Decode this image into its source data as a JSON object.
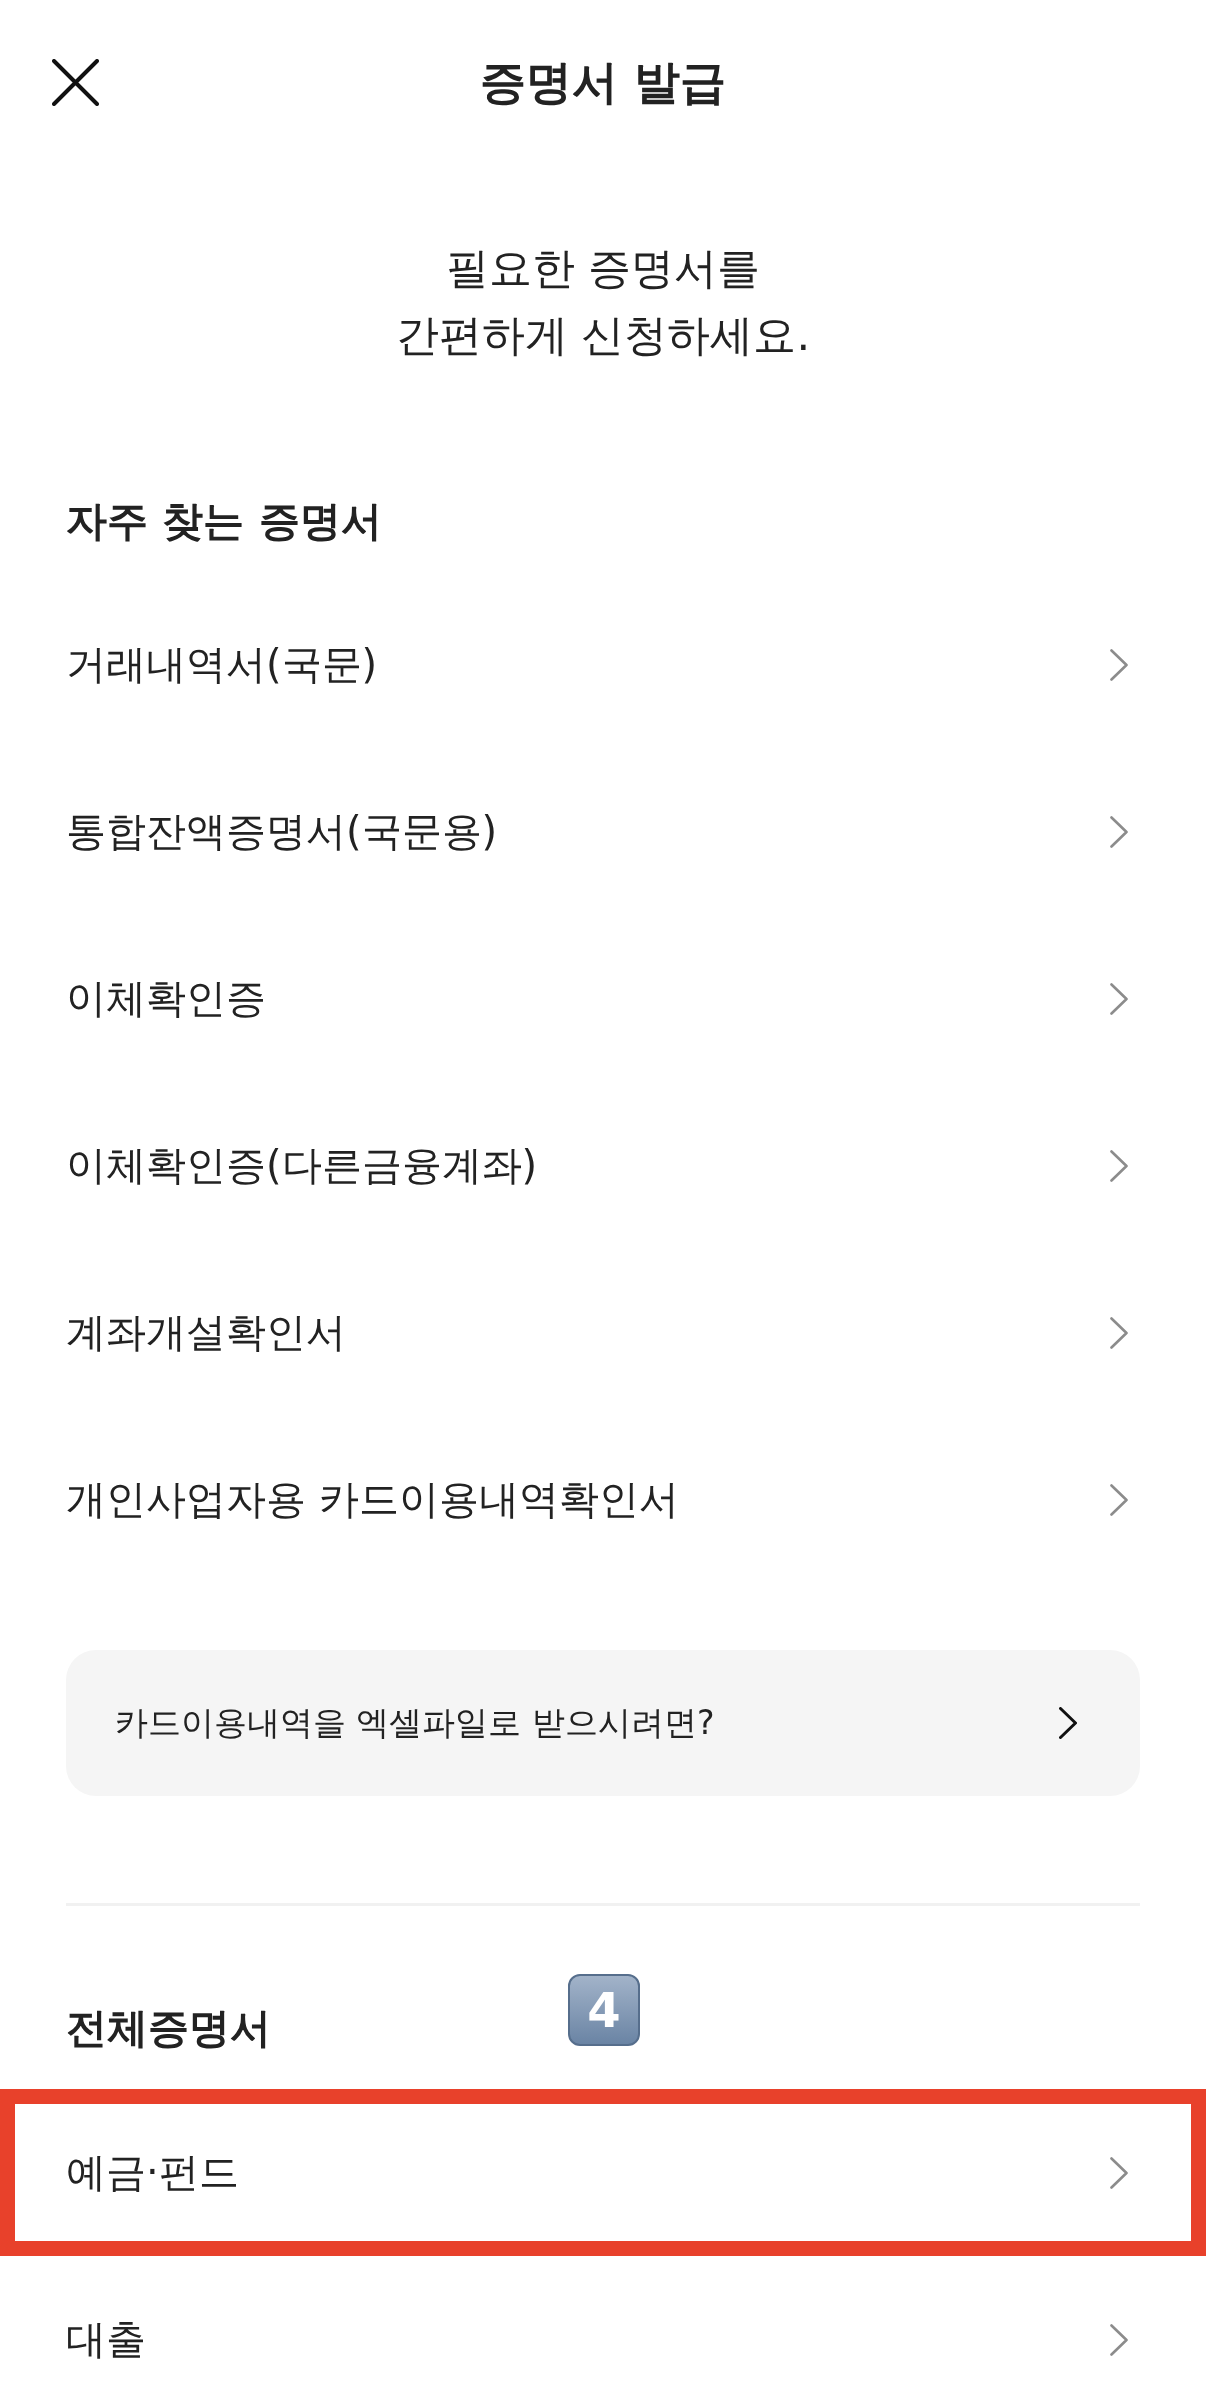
{
  "header": {
    "title": "증명서 발급"
  },
  "intro": {
    "text": "필요한 증명서를\n간편하게 신청하세요."
  },
  "frequent": {
    "heading": "자주 찾는 증명서",
    "items": [
      {
        "label": "거래내역서(국문)"
      },
      {
        "label": "통합잔액증명서(국문용)"
      },
      {
        "label": "이체확인증"
      },
      {
        "label": "이체확인증(다른금융계좌)"
      },
      {
        "label": "계좌개설확인서"
      },
      {
        "label": "개인사업자용 카드이용내역확인서"
      }
    ]
  },
  "excel_banner": {
    "text": "카드이용내역을 엑셀파일로 받으시려면?"
  },
  "all_certificates": {
    "heading": "전체증명서",
    "step_badge": {
      "label": "4"
    },
    "items": [
      {
        "label": "예금·펀드",
        "highlighted": true
      },
      {
        "label": "대출",
        "highlighted": false
      }
    ]
  }
}
